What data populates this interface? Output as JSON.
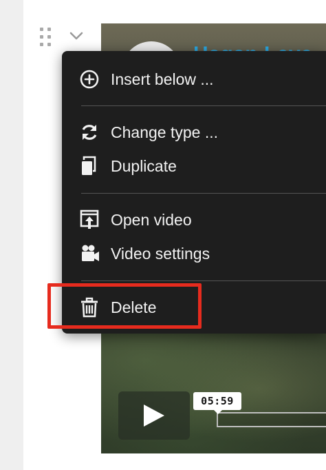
{
  "editor": {
    "block_controls": {
      "drag_icon": "drag-handle-icon",
      "collapse_icon": "chevron-down-icon"
    }
  },
  "video": {
    "channel_name": "Hagan Leve",
    "current_time": "05:59",
    "play_icon": "play-icon"
  },
  "context_menu": {
    "items": [
      {
        "id": "insert-below",
        "label": "Insert below ...",
        "icon": "plus-circle-icon"
      },
      {
        "id": "change-type",
        "label": "Change type ...",
        "icon": "refresh-icon"
      },
      {
        "id": "duplicate",
        "label": "Duplicate",
        "icon": "duplicate-icon"
      },
      {
        "id": "open-video",
        "label": "Open video",
        "icon": "open-external-icon"
      },
      {
        "id": "video-settings",
        "label": "Video settings",
        "icon": "video-camera-icon"
      },
      {
        "id": "delete",
        "label": "Delete",
        "icon": "trash-icon"
      }
    ]
  },
  "colors": {
    "menu_background": "#1e1e1e",
    "highlight": "#e62b1e",
    "channel_name": "#2aa7e0"
  }
}
